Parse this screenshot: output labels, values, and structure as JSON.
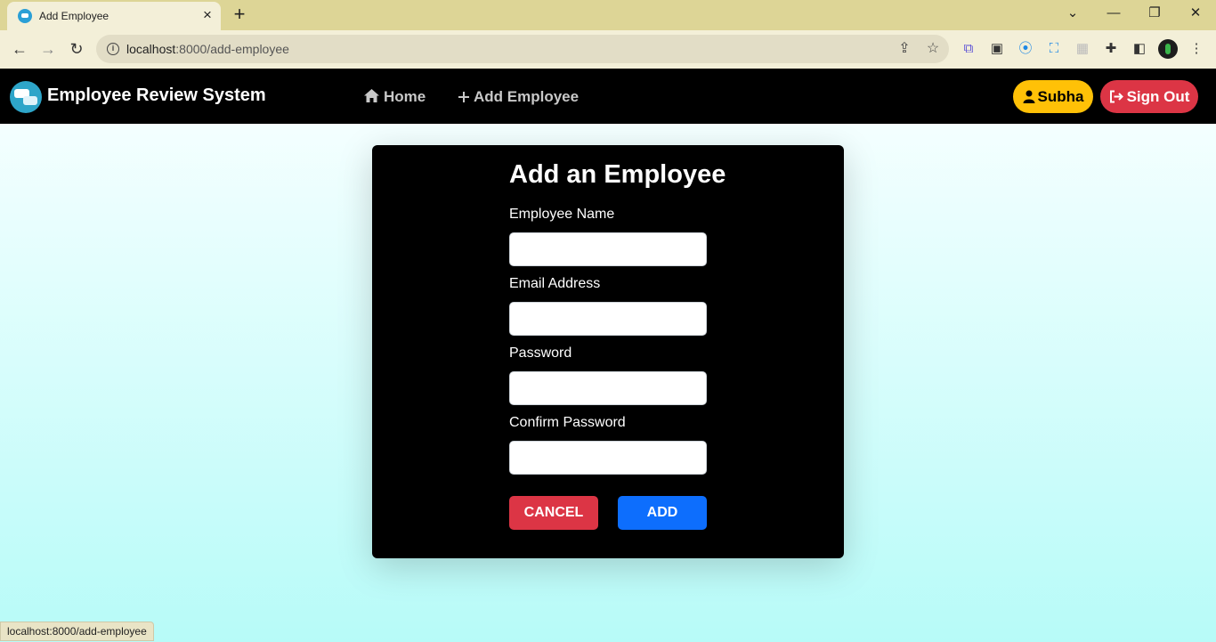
{
  "browser": {
    "tab_title": "Add Employee",
    "url_host": "localhost",
    "url_rest": ":8000/add-employee",
    "status_text": "localhost:8000/add-employee"
  },
  "navbar": {
    "brand": "Employee Review System",
    "links": [
      {
        "label": "Home",
        "icon": "home-icon"
      },
      {
        "label": "Add Employee",
        "icon": "plus-icon"
      }
    ],
    "user_label": "Subha",
    "signout_label": "Sign Out"
  },
  "form": {
    "title": "Add an Employee",
    "fields": [
      {
        "label": "Employee Name",
        "value": ""
      },
      {
        "label": "Email Address",
        "value": ""
      },
      {
        "label": "Password",
        "value": ""
      },
      {
        "label": "Confirm Password",
        "value": ""
      }
    ],
    "cancel_label": "CANCEL",
    "add_label": "ADD"
  },
  "colors": {
    "navbar_bg": "#000000",
    "user_btn": "#ffc107",
    "signout_btn": "#dc3545",
    "cancel_btn": "#dc3545",
    "add_btn": "#0d6efd",
    "page_gradient_top": "#f4ffff",
    "page_gradient_bottom": "#b7fbf8"
  }
}
